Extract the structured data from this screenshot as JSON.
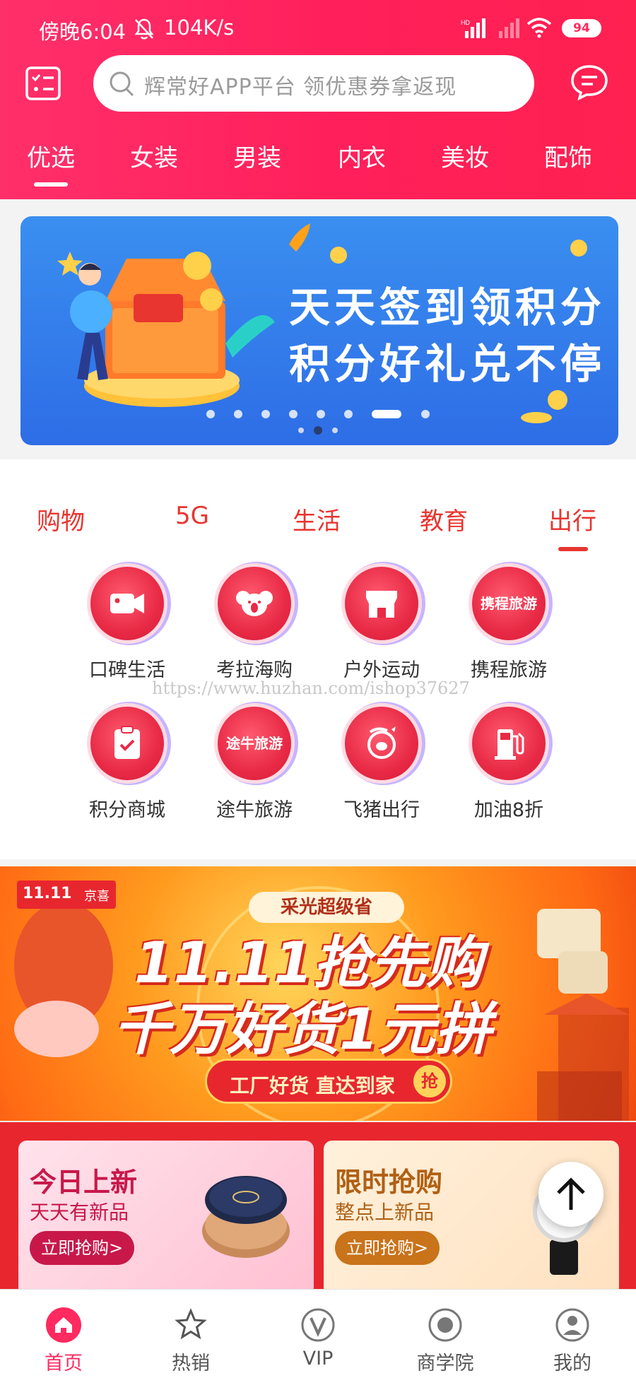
{
  "status_bar": {
    "time": "傍晚6:04",
    "net_speed": "104K/s",
    "battery": "94"
  },
  "header": {
    "search_placeholder": "辉常好APP平台  领优惠券拿返现",
    "categories": [
      "优选",
      "女装",
      "男装",
      "内衣",
      "美妆",
      "配饰"
    ],
    "active_category": 0
  },
  "banner": {
    "line1": "天天签到领积分",
    "line2": "积分好礼兑不停",
    "slide_count": 8,
    "active_slide": 6
  },
  "services": {
    "tabs": [
      "购物",
      "5G",
      "生活",
      "教育",
      "出行"
    ],
    "active_tab": 4,
    "items": [
      {
        "label": "口碑生活",
        "icon": "video-camera-icon"
      },
      {
        "label": "考拉海购",
        "icon": "koala-icon"
      },
      {
        "label": "户外运动",
        "icon": "storefront-icon"
      },
      {
        "label": "携程旅游",
        "icon": "ctrip-text-icon",
        "icon_text": "携程旅游"
      },
      {
        "label": "积分商城",
        "icon": "clipboard-check-icon"
      },
      {
        "label": "途牛旅游",
        "icon": "tuniu-text-icon",
        "icon_text": "途牛旅游"
      },
      {
        "label": "飞猪出行",
        "icon": "fliggy-pig-icon"
      },
      {
        "label": "加油8折",
        "icon": "fuel-pump-icon"
      }
    ],
    "watermark": "https://www.huzhan.com/ishop37627"
  },
  "promo": {
    "badge_number": "11.11",
    "badge_brand": "京喜",
    "pill": "采光超级省",
    "headline1": "11.11抢先购",
    "headline2": "千万好货1元拼",
    "cta": "工厂好货 直达到家",
    "cta_badge": "抢"
  },
  "deals": [
    {
      "title": "今日上新",
      "subtitle": "天天有新品",
      "button": "立即抢购>"
    },
    {
      "title": "限时抢购",
      "subtitle": "整点上新品",
      "button": "立即抢购>"
    }
  ],
  "bottom_nav": {
    "items": [
      "首页",
      "热销",
      "VIP",
      "商学院",
      "我的"
    ],
    "active": 0
  },
  "colors": {
    "brand": "#ff2a5f",
    "service_accent": "#e8352f",
    "banner_blue": "#3a8ff0"
  }
}
